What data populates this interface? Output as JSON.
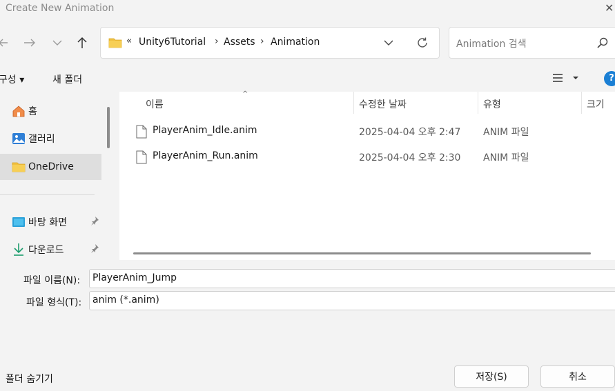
{
  "window": {
    "title": "Create New Animation"
  },
  "address_bar": {
    "overflow": "«",
    "crumbs": [
      "Unity6Tutorial",
      "Assets",
      "Animation"
    ]
  },
  "search": {
    "placeholder": "Animation 검색"
  },
  "toolbar": {
    "organize": "구성 ▾",
    "new_folder": "새 폴더",
    "help": "?"
  },
  "nav_pane": {
    "items": [
      {
        "label": "홈",
        "icon": "home-icon"
      },
      {
        "label": "갤러리",
        "icon": "gallery-icon"
      },
      {
        "label": "OneDrive",
        "icon": "folder-icon"
      },
      {
        "label": "바탕 화면",
        "icon": "desktop-icon"
      },
      {
        "label": "다운로드",
        "icon": "download-icon"
      }
    ]
  },
  "file_list": {
    "columns": [
      "이름",
      "수정한 날짜",
      "유형",
      "크기"
    ],
    "rows": [
      {
        "name": "PlayerAnim_Idle.anim",
        "date": "2025-04-04 오후 2:47",
        "type": "ANIM 파일"
      },
      {
        "name": "PlayerAnim_Run.anim",
        "date": "2025-04-04 오후 2:30",
        "type": "ANIM 파일"
      }
    ]
  },
  "form": {
    "filename_label": "파일 이름(N):",
    "filename_value": "PlayerAnim_Jump",
    "filetype_label": "파일 형식(T):",
    "filetype_value": "anim (*.anim)"
  },
  "footer": {
    "hide_folders": "폴더 숨기기",
    "save": "저장(S)",
    "cancel": "취소"
  },
  "colors": {
    "accent": "#1a7fd4",
    "folder": "#f0c040",
    "selected_nav": "#dedede"
  }
}
